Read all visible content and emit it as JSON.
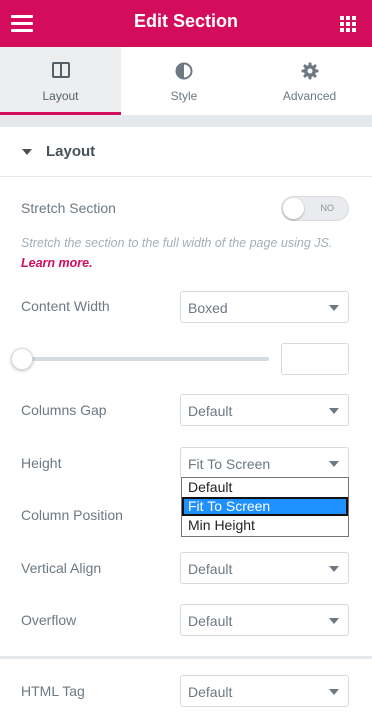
{
  "header": {
    "title": "Edit Section"
  },
  "tabs": [
    {
      "label": "Layout",
      "icon": "columns-icon",
      "active": true
    },
    {
      "label": "Style",
      "icon": "contrast-icon",
      "active": false
    },
    {
      "label": "Advanced",
      "icon": "gear-icon",
      "active": false
    }
  ],
  "section": {
    "title": "Layout"
  },
  "stretch": {
    "label": "Stretch Section",
    "toggle_text": "NO",
    "description": "Stretch the section to the full width of the page using JS.",
    "learn_more": "Learn more."
  },
  "content_width": {
    "label": "Content Width",
    "value": "Boxed"
  },
  "width_slider": {
    "value": "",
    "level": 0
  },
  "columns_gap": {
    "label": "Columns Gap",
    "value": "Default"
  },
  "height": {
    "label": "Height",
    "value": "Fit To Screen",
    "options": [
      "Default",
      "Fit To Screen",
      "Min Height"
    ]
  },
  "column_position": {
    "label": "Column Position"
  },
  "vertical_align": {
    "label": "Vertical Align",
    "value": "Default"
  },
  "overflow": {
    "label": "Overflow",
    "value": "Default"
  },
  "html_tag": {
    "label": "HTML Tag",
    "value": "Default"
  },
  "colors": {
    "accent": "#d30c5c",
    "selected_option": "#1e90ff"
  }
}
